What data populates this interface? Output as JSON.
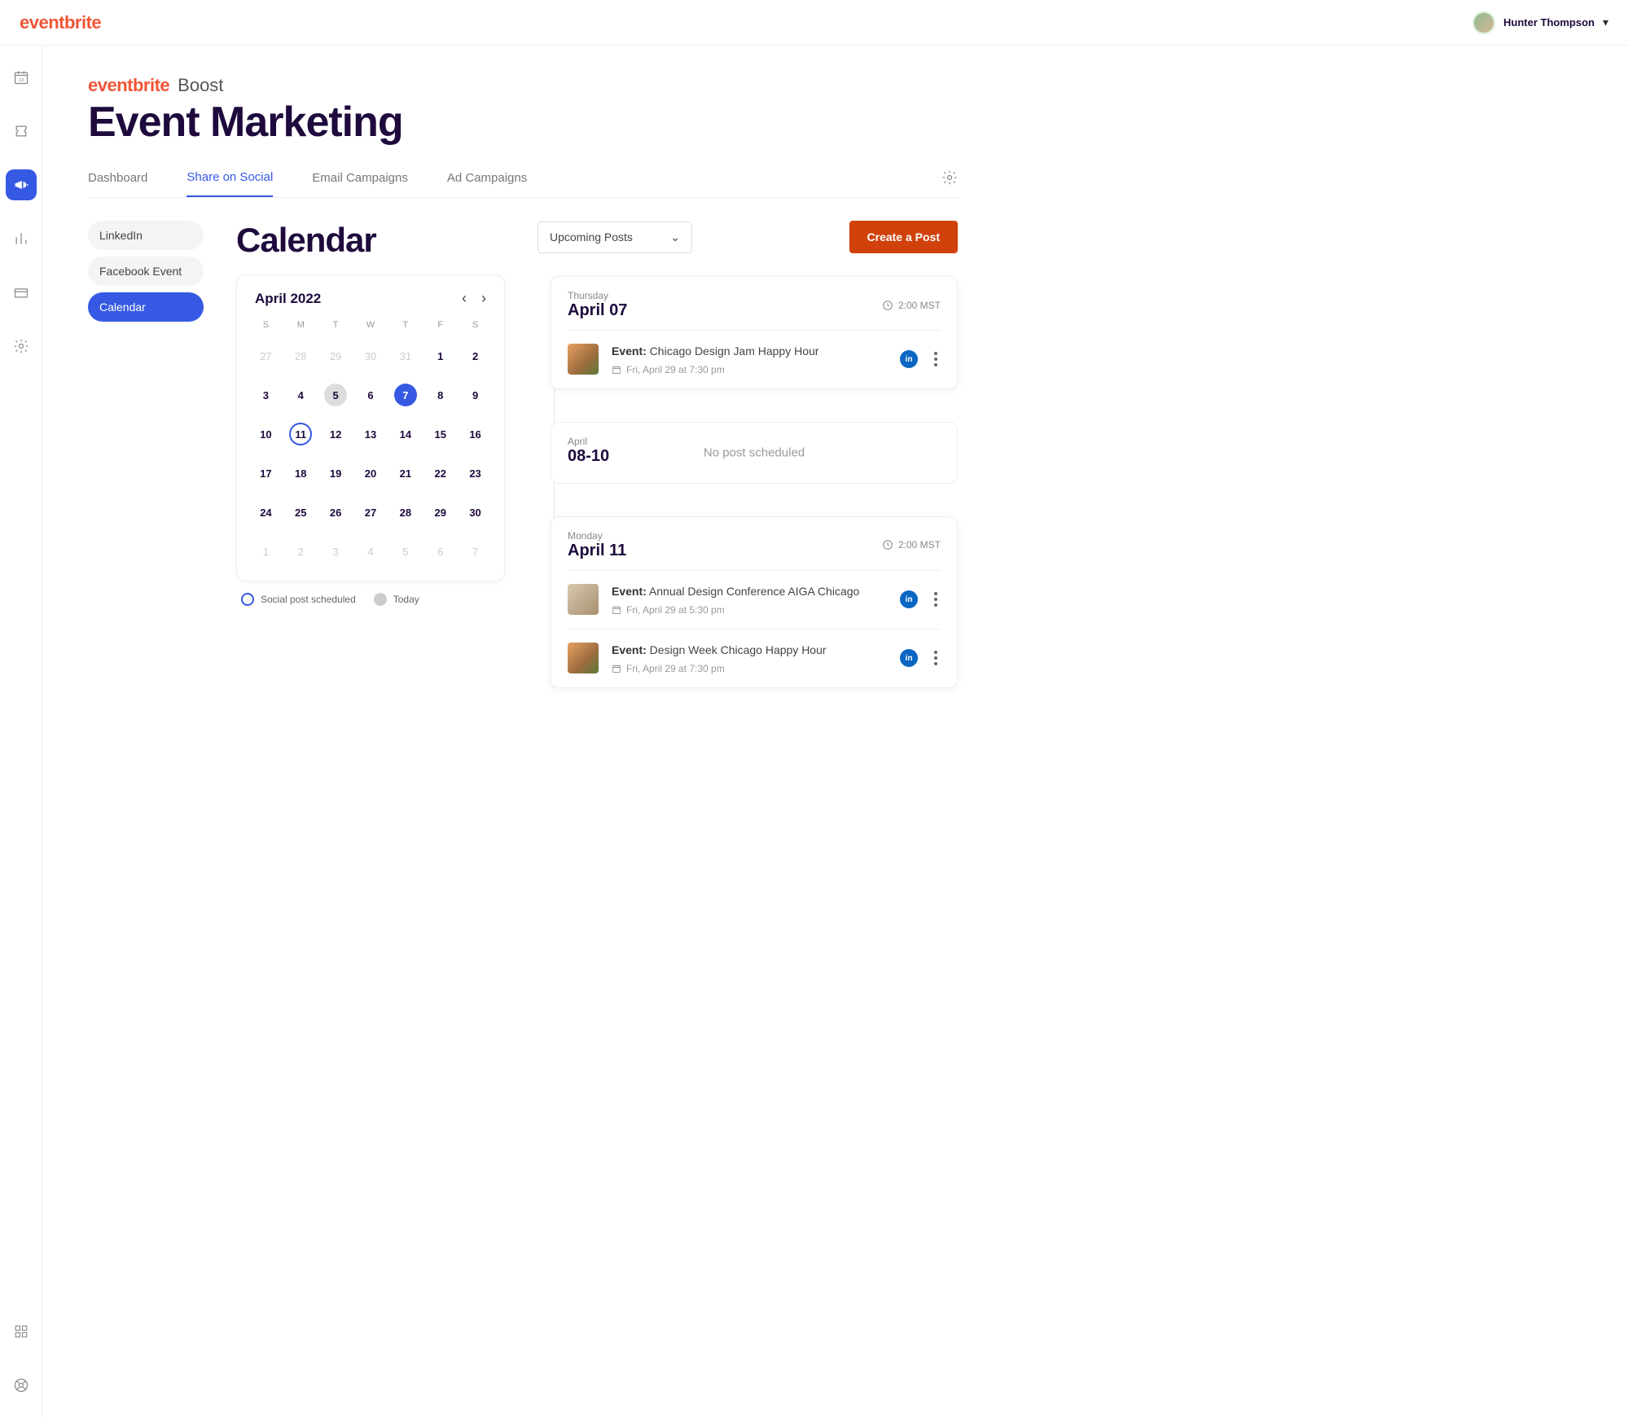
{
  "brand": "eventbrite",
  "user": {
    "name": "Hunter Thompson"
  },
  "boost": {
    "brand": "eventbrite",
    "word": "Boost"
  },
  "page_title": "Event Marketing",
  "tabs": [
    {
      "label": "Dashboard"
    },
    {
      "label": "Share on Social"
    },
    {
      "label": "Email Campaigns"
    },
    {
      "label": "Ad Campaigns"
    }
  ],
  "subnav": [
    {
      "label": "LinkedIn"
    },
    {
      "label": "Facebook Event"
    },
    {
      "label": "Calendar"
    }
  ],
  "calendar": {
    "title": "Calendar",
    "month_label": "April 2022",
    "dow": [
      "S",
      "M",
      "T",
      "W",
      "T",
      "F",
      "S"
    ],
    "weeks": [
      [
        {
          "n": "27",
          "muted": true
        },
        {
          "n": "28",
          "muted": true
        },
        {
          "n": "29",
          "muted": true
        },
        {
          "n": "30",
          "muted": true
        },
        {
          "n": "31",
          "muted": true
        },
        {
          "n": "1"
        },
        {
          "n": "2"
        }
      ],
      [
        {
          "n": "3"
        },
        {
          "n": "4"
        },
        {
          "n": "5",
          "today": true
        },
        {
          "n": "6"
        },
        {
          "n": "7",
          "selected": true
        },
        {
          "n": "8"
        },
        {
          "n": "9"
        }
      ],
      [
        {
          "n": "10"
        },
        {
          "n": "11",
          "ring": true
        },
        {
          "n": "12"
        },
        {
          "n": "13"
        },
        {
          "n": "14"
        },
        {
          "n": "15"
        },
        {
          "n": "16"
        }
      ],
      [
        {
          "n": "17"
        },
        {
          "n": "18"
        },
        {
          "n": "19"
        },
        {
          "n": "20"
        },
        {
          "n": "21"
        },
        {
          "n": "22"
        },
        {
          "n": "23"
        }
      ],
      [
        {
          "n": "24"
        },
        {
          "n": "25"
        },
        {
          "n": "26"
        },
        {
          "n": "27"
        },
        {
          "n": "28"
        },
        {
          "n": "29"
        },
        {
          "n": "30"
        }
      ],
      [
        {
          "n": "1",
          "muted": true
        },
        {
          "n": "2",
          "muted": true
        },
        {
          "n": "3",
          "muted": true
        },
        {
          "n": "4",
          "muted": true
        },
        {
          "n": "5",
          "muted": true
        },
        {
          "n": "6",
          "muted": true
        },
        {
          "n": "7",
          "muted": true
        }
      ]
    ],
    "legend": {
      "scheduled": "Social post scheduled",
      "today": "Today"
    }
  },
  "filter": {
    "label": "Upcoming Posts"
  },
  "create_btn": "Create a Post",
  "days": [
    {
      "weekday": "Thursday",
      "date": "April 07",
      "time": "2:00 MST",
      "posts": [
        {
          "prefix": "Event:",
          "name": "Chicago Design Jam Happy Hour",
          "when": "Fri, April 29 at 7:30 pm",
          "network": "linkedin",
          "thumb": "drink"
        }
      ]
    },
    {
      "weekday": "April",
      "date": "08-10",
      "empty_text": "No post scheduled",
      "empty": true
    },
    {
      "weekday": "Monday",
      "date": "April 11",
      "time": "2:00 MST",
      "posts": [
        {
          "prefix": "Event:",
          "name": "Annual Design Conference AIGA Chicago",
          "when": "Fri, April 29 at 5:30 pm",
          "network": "linkedin",
          "thumb": "paper"
        },
        {
          "prefix": "Event:",
          "name": "Design Week Chicago Happy Hour",
          "when": "Fri, April 29 at 7:30 pm",
          "network": "linkedin",
          "thumb": "drink"
        }
      ]
    }
  ]
}
